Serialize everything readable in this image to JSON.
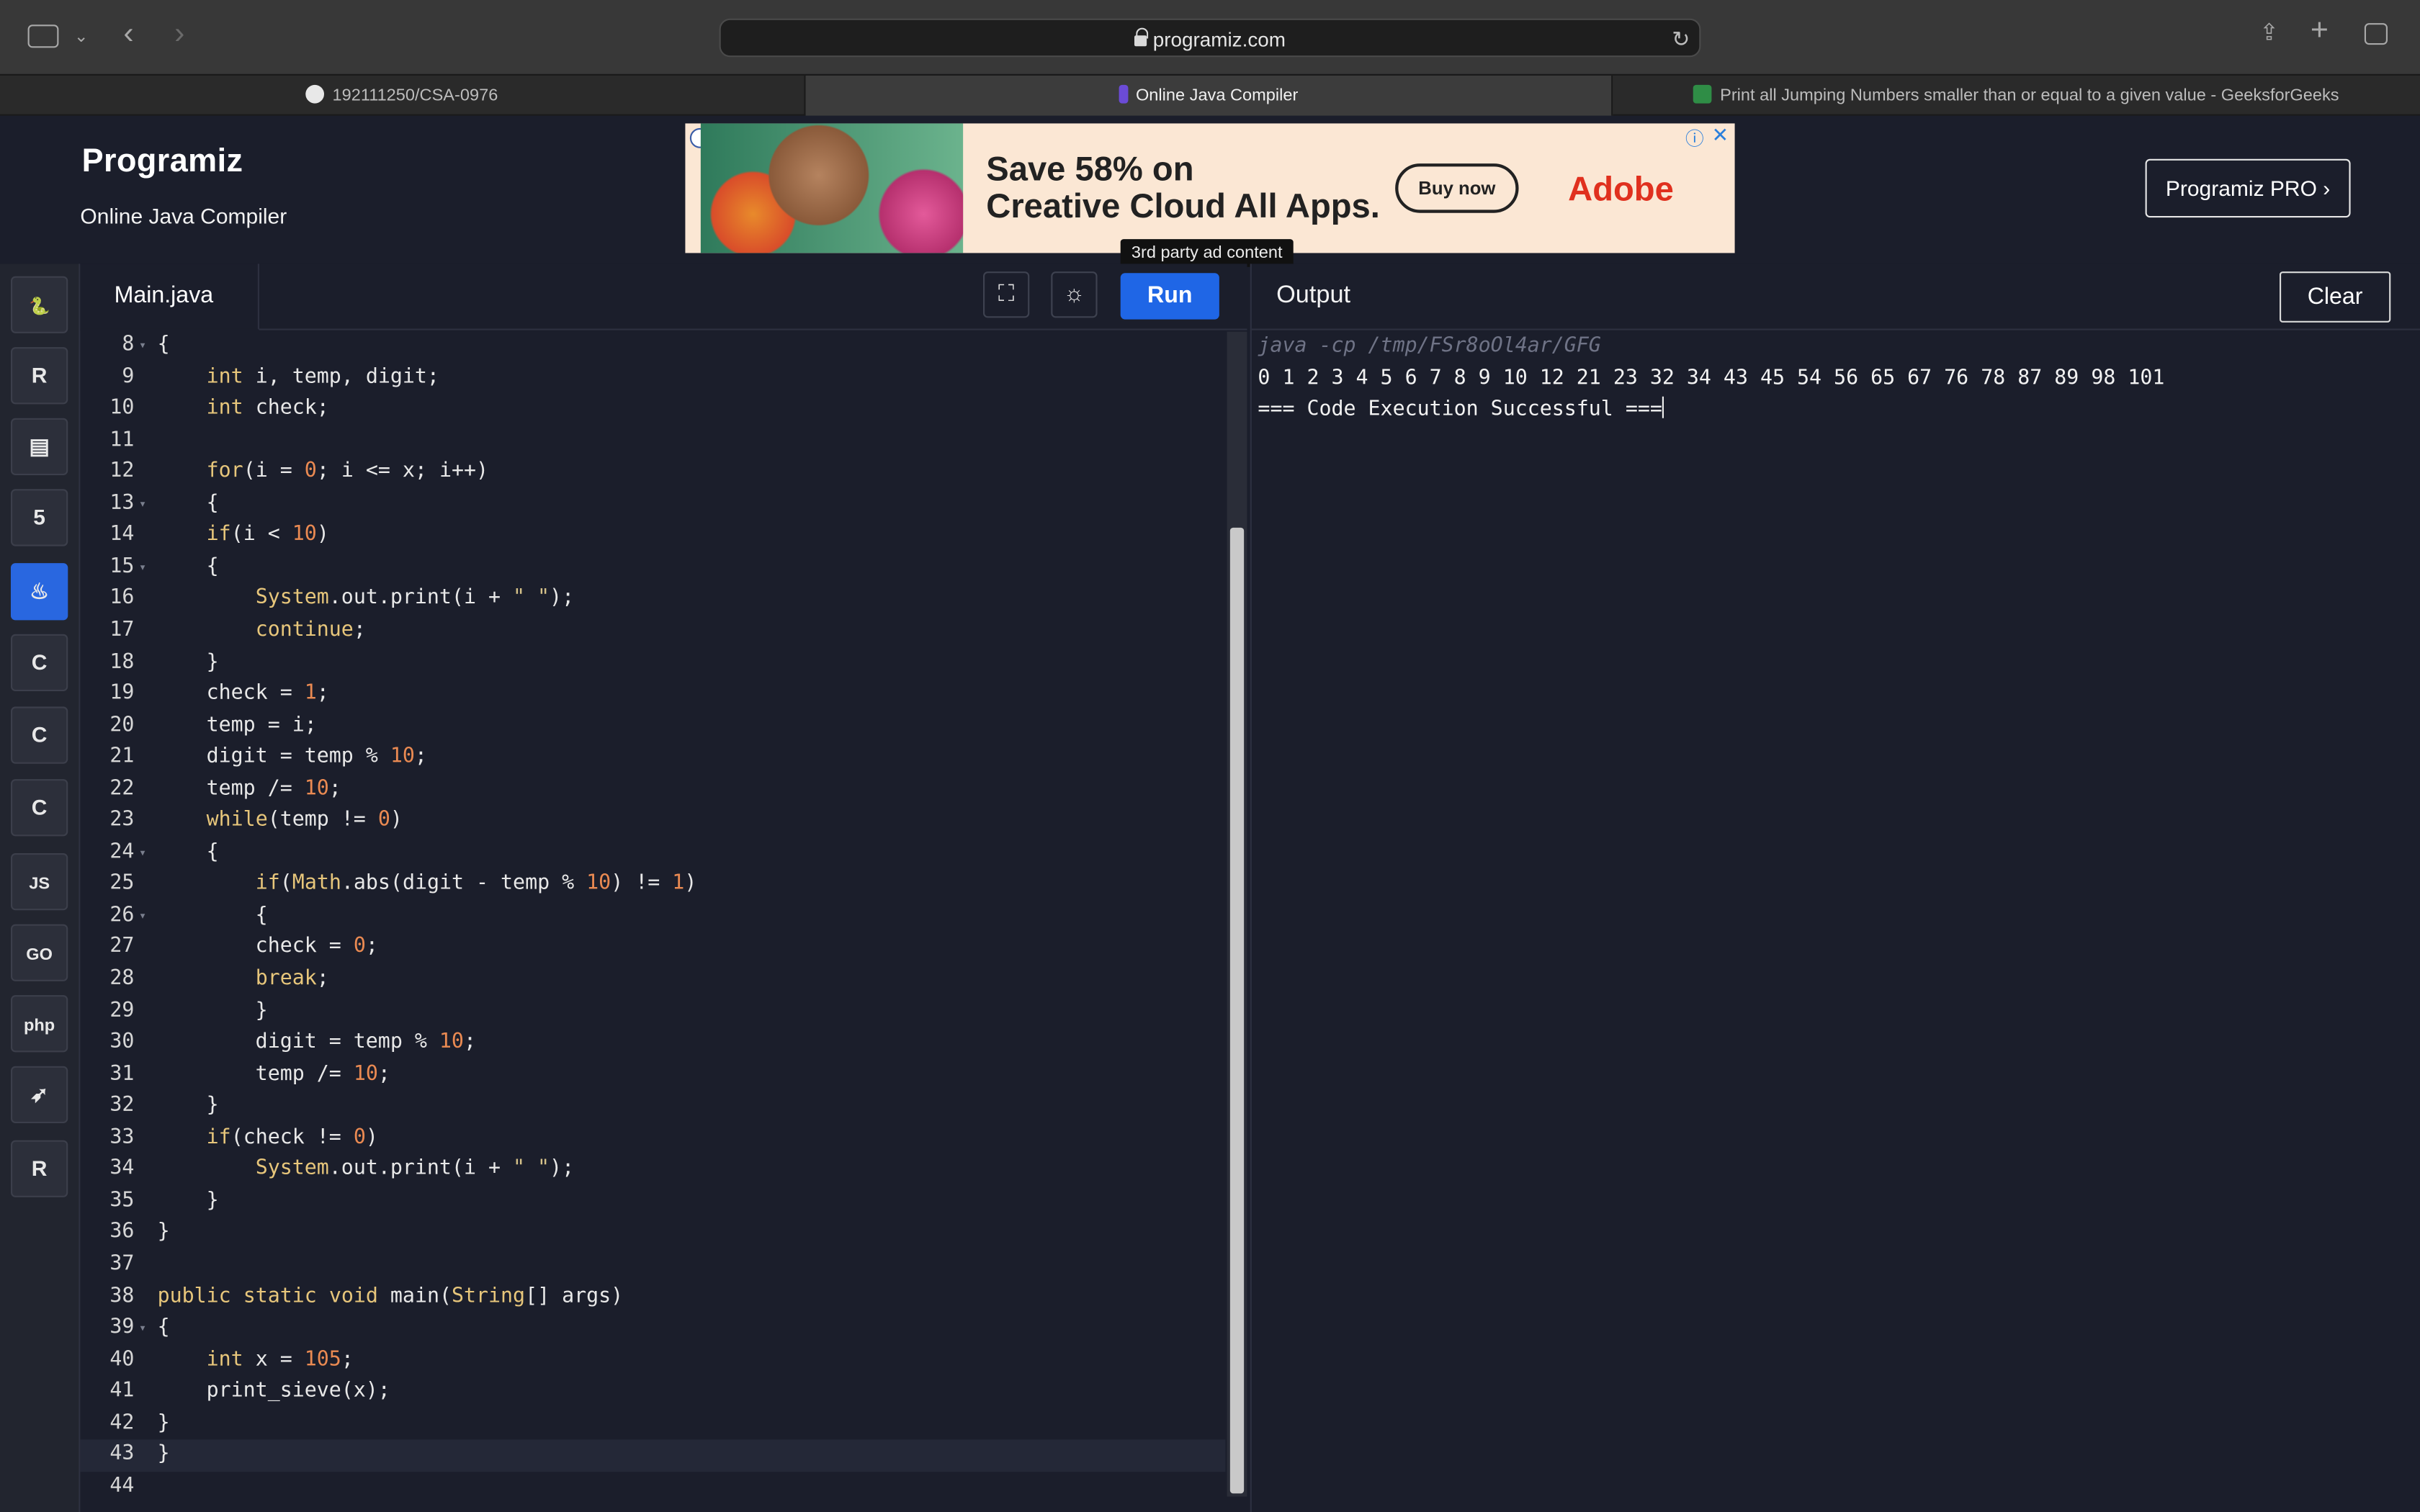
{
  "browser": {
    "url": "programiz.com",
    "tabs": [
      {
        "label": "192111250/CSA-0976",
        "active": false
      },
      {
        "label": "Online Java Compiler",
        "active": true
      },
      {
        "label": "Print all Jumping Numbers smaller than or equal to a given value - GeeksforGeeks",
        "active": false
      }
    ]
  },
  "site": {
    "logo": "Programiz",
    "subtitle": "Online Java Compiler",
    "pro_button": "Programiz PRO ›",
    "ad": {
      "headline_1": "Save 58% on",
      "headline_2": "Creative Cloud All Apps.",
      "cta": "Buy now",
      "brand": "Adobe",
      "note": "3rd party ad content"
    }
  },
  "sidebar": {
    "languages": [
      {
        "name": "python-icon",
        "glyph": "🐍",
        "active": false
      },
      {
        "name": "r-icon",
        "glyph": "R",
        "active": false
      },
      {
        "name": "sql-icon",
        "glyph": "▤",
        "active": false
      },
      {
        "name": "html5-icon",
        "glyph": "5",
        "active": false
      },
      {
        "name": "java-icon",
        "glyph": "♨",
        "active": true
      },
      {
        "name": "c-icon",
        "glyph": "C",
        "active": false
      },
      {
        "name": "cpp-icon",
        "glyph": "C",
        "active": false
      },
      {
        "name": "csharp-icon",
        "glyph": "C",
        "active": false
      },
      {
        "name": "javascript-icon",
        "glyph": "JS",
        "active": false
      },
      {
        "name": "go-icon",
        "glyph": "GO",
        "active": false
      },
      {
        "name": "php-icon",
        "glyph": "php",
        "active": false
      },
      {
        "name": "swift-icon",
        "glyph": "➶",
        "active": false
      },
      {
        "name": "rust-icon",
        "glyph": "R",
        "active": false
      }
    ]
  },
  "editor": {
    "filename": "Main.java",
    "run_label": "Run",
    "lines": [
      {
        "n": "8",
        "fold": true,
        "text": "{"
      },
      {
        "n": "9",
        "fold": false,
        "text": "    int i, temp, digit;"
      },
      {
        "n": "10",
        "fold": false,
        "text": "    int check;"
      },
      {
        "n": "11",
        "fold": false,
        "text": ""
      },
      {
        "n": "12",
        "fold": false,
        "text": "    for(i = 0; i <= x; i++)"
      },
      {
        "n": "13",
        "fold": true,
        "text": "    {"
      },
      {
        "n": "14",
        "fold": false,
        "text": "    if(i < 10)"
      },
      {
        "n": "15",
        "fold": true,
        "text": "    {"
      },
      {
        "n": "16",
        "fold": false,
        "text": "        System.out.print(i + \" \");"
      },
      {
        "n": "17",
        "fold": false,
        "text": "        continue;"
      },
      {
        "n": "18",
        "fold": false,
        "text": "    }"
      },
      {
        "n": "19",
        "fold": false,
        "text": "    check = 1;"
      },
      {
        "n": "20",
        "fold": false,
        "text": "    temp = i;"
      },
      {
        "n": "21",
        "fold": false,
        "text": "    digit = temp % 10;"
      },
      {
        "n": "22",
        "fold": false,
        "text": "    temp /= 10;"
      },
      {
        "n": "23",
        "fold": false,
        "text": "    while(temp != 0)"
      },
      {
        "n": "24",
        "fold": true,
        "text": "    {"
      },
      {
        "n": "25",
        "fold": false,
        "text": "        if(Math.abs(digit - temp % 10) != 1)"
      },
      {
        "n": "26",
        "fold": true,
        "text": "        {"
      },
      {
        "n": "27",
        "fold": false,
        "text": "        check = 0;"
      },
      {
        "n": "28",
        "fold": false,
        "text": "        break;"
      },
      {
        "n": "29",
        "fold": false,
        "text": "        }"
      },
      {
        "n": "30",
        "fold": false,
        "text": "        digit = temp % 10;"
      },
      {
        "n": "31",
        "fold": false,
        "text": "        temp /= 10;"
      },
      {
        "n": "32",
        "fold": false,
        "text": "    }"
      },
      {
        "n": "33",
        "fold": false,
        "text": "    if(check != 0)"
      },
      {
        "n": "34",
        "fold": false,
        "text": "        System.out.print(i + \" \");"
      },
      {
        "n": "35",
        "fold": false,
        "text": "    }"
      },
      {
        "n": "36",
        "fold": false,
        "text": "}"
      },
      {
        "n": "37",
        "fold": false,
        "text": ""
      },
      {
        "n": "38",
        "fold": false,
        "text": "public static void main(String[] args)"
      },
      {
        "n": "39",
        "fold": true,
        "text": "{"
      },
      {
        "n": "40",
        "fold": false,
        "text": "    int x = 105;"
      },
      {
        "n": "41",
        "fold": false,
        "text": "    print_sieve(x);"
      },
      {
        "n": "42",
        "fold": false,
        "text": "}"
      },
      {
        "n": "43",
        "fold": false,
        "text": "}",
        "current": true
      },
      {
        "n": "44",
        "fold": false,
        "text": ""
      }
    ]
  },
  "output": {
    "title": "Output",
    "clear_label": "Clear",
    "command": "java -cp /tmp/FSr8oOl4ar/GFG",
    "result": "0 1 2 3 4 5 6 7 8 9 10 12 21 23 32 34 43 45 54 56 65 67 76 78 87 89 98 101",
    "status": "=== Code Execution Successful ==="
  }
}
